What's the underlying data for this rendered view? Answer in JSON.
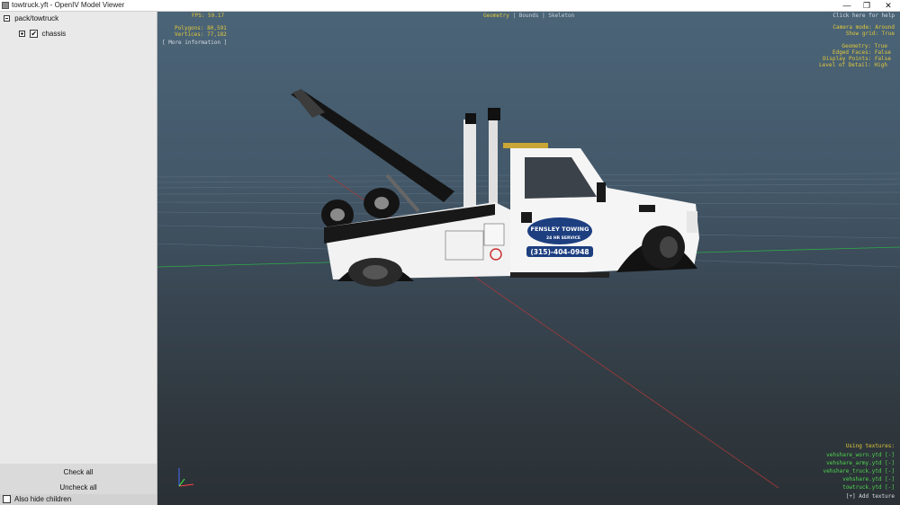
{
  "window": {
    "title": "towtruck.yft - OpenIV Model Viewer",
    "minimize_glyph": "—",
    "maximize_glyph": "❐",
    "close_glyph": "✕"
  },
  "sidebar": {
    "root_label": "pack/towtruck",
    "child_label": "chassis",
    "check_all": "Check all",
    "uncheck_all": "Uncheck all",
    "also_hide_children": "Also hide children"
  },
  "hud": {
    "fps": "FPS: 59.17",
    "polygons": "Polygons: 80,591",
    "vertices": "Vertices: 77,182",
    "more_info": "[ More information ]",
    "tab_geometry": "Geometry",
    "tab_sep1": "|",
    "tab_bounds": "Bounds",
    "tab_sep2": "|",
    "tab_skeleton": "Skeleton",
    "help": "Click here for help",
    "camera_mode": "Camera mode: Around",
    "show_grid": "Show grid: True",
    "geometry_state": "Geometry: True",
    "edged_faces": "Edged Faces: False",
    "display_points": "Display Points: False",
    "level_of_detail": "Level of Detail: High",
    "using_textures": "Using textures:",
    "textures": [
      "vehshare_worn.ytd [-]",
      "vehshare_army.ytd [-]",
      "vehshare_truck.ytd [-]",
      "vehshare.ytd [-]",
      "towtruck.ytd [-]"
    ],
    "add_texture": "[+] Add texture"
  },
  "truck_decals": {
    "company": "FENSLEY TOWING",
    "service": "24 HR SERVICE",
    "phone": "(315)-404-0948"
  },
  "colors": {
    "hud_yellow": "#e2c83c",
    "hud_green": "#4fd64f",
    "sidebar_bg": "#e9e9e9",
    "viewport_top": "#4a6477",
    "viewport_bottom": "#2a3035"
  }
}
